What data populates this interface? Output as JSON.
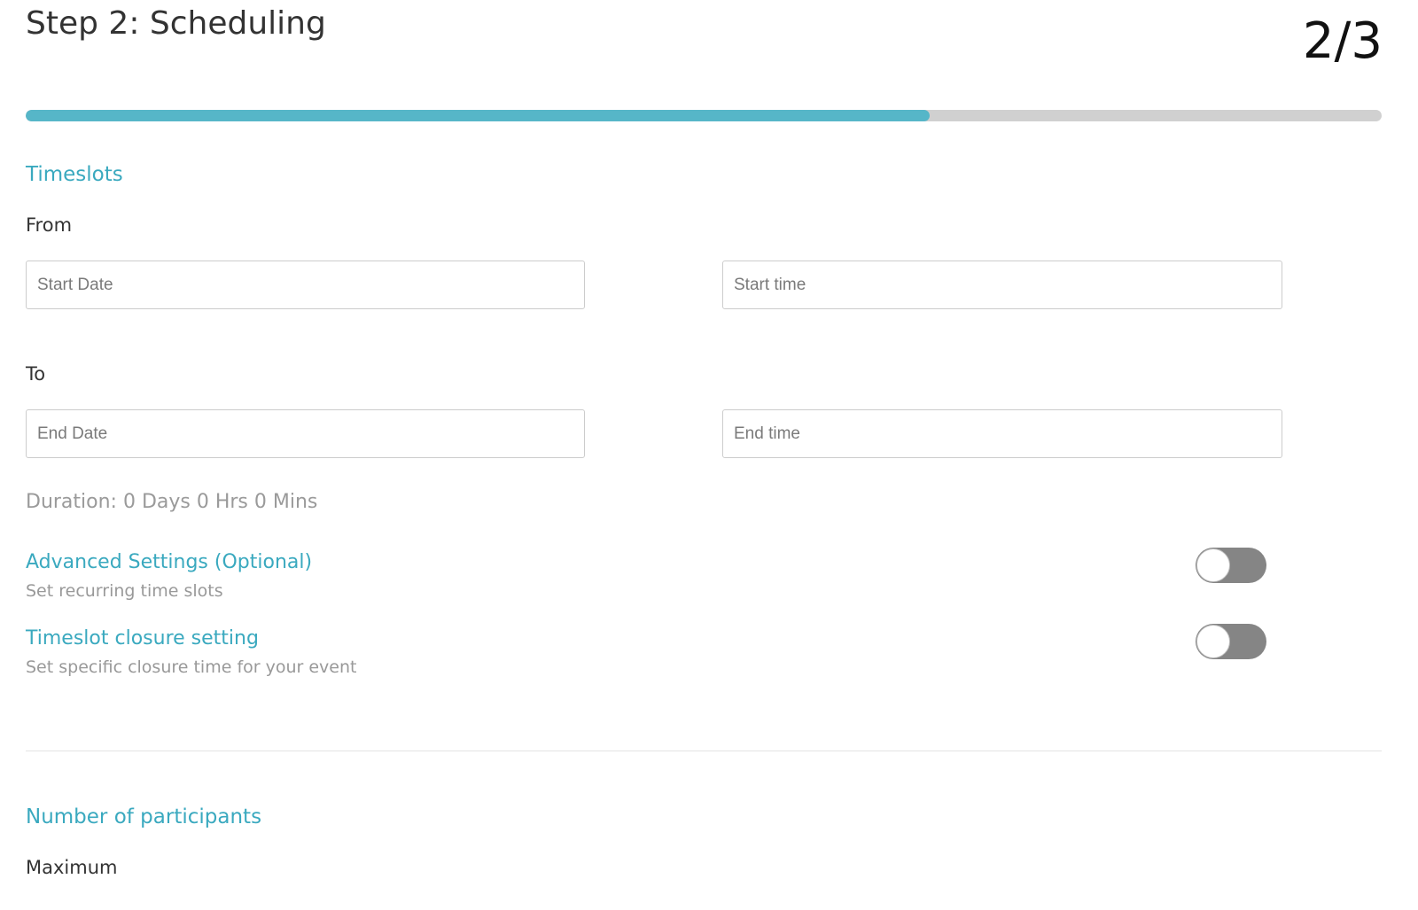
{
  "header": {
    "step_title": "Step 2: Scheduling",
    "step_counter": "2/3",
    "progress": 0.6667
  },
  "colors": {
    "accent": "#3aa9bf",
    "progress_fill": "#56b6c8",
    "progress_track": "#d0d0d0",
    "toggle_off": "#858585"
  },
  "timeslots": {
    "heading": "Timeslots",
    "from_label": "From",
    "start_date_placeholder": "Start Date",
    "start_time_placeholder": "Start time",
    "to_label": "To",
    "end_date_placeholder": "End Date",
    "end_time_placeholder": "End time",
    "duration": "Duration: 0 Days 0 Hrs 0 Mins"
  },
  "advanced_settings": {
    "title": "Advanced Settings (Optional)",
    "subtitle": "Set recurring time slots",
    "enabled": false
  },
  "closure_setting": {
    "title": "Timeslot closure setting",
    "subtitle": "Set specific closure time for your event",
    "enabled": false
  },
  "participants": {
    "heading": "Number of participants",
    "maximum_label": "Maximum"
  }
}
